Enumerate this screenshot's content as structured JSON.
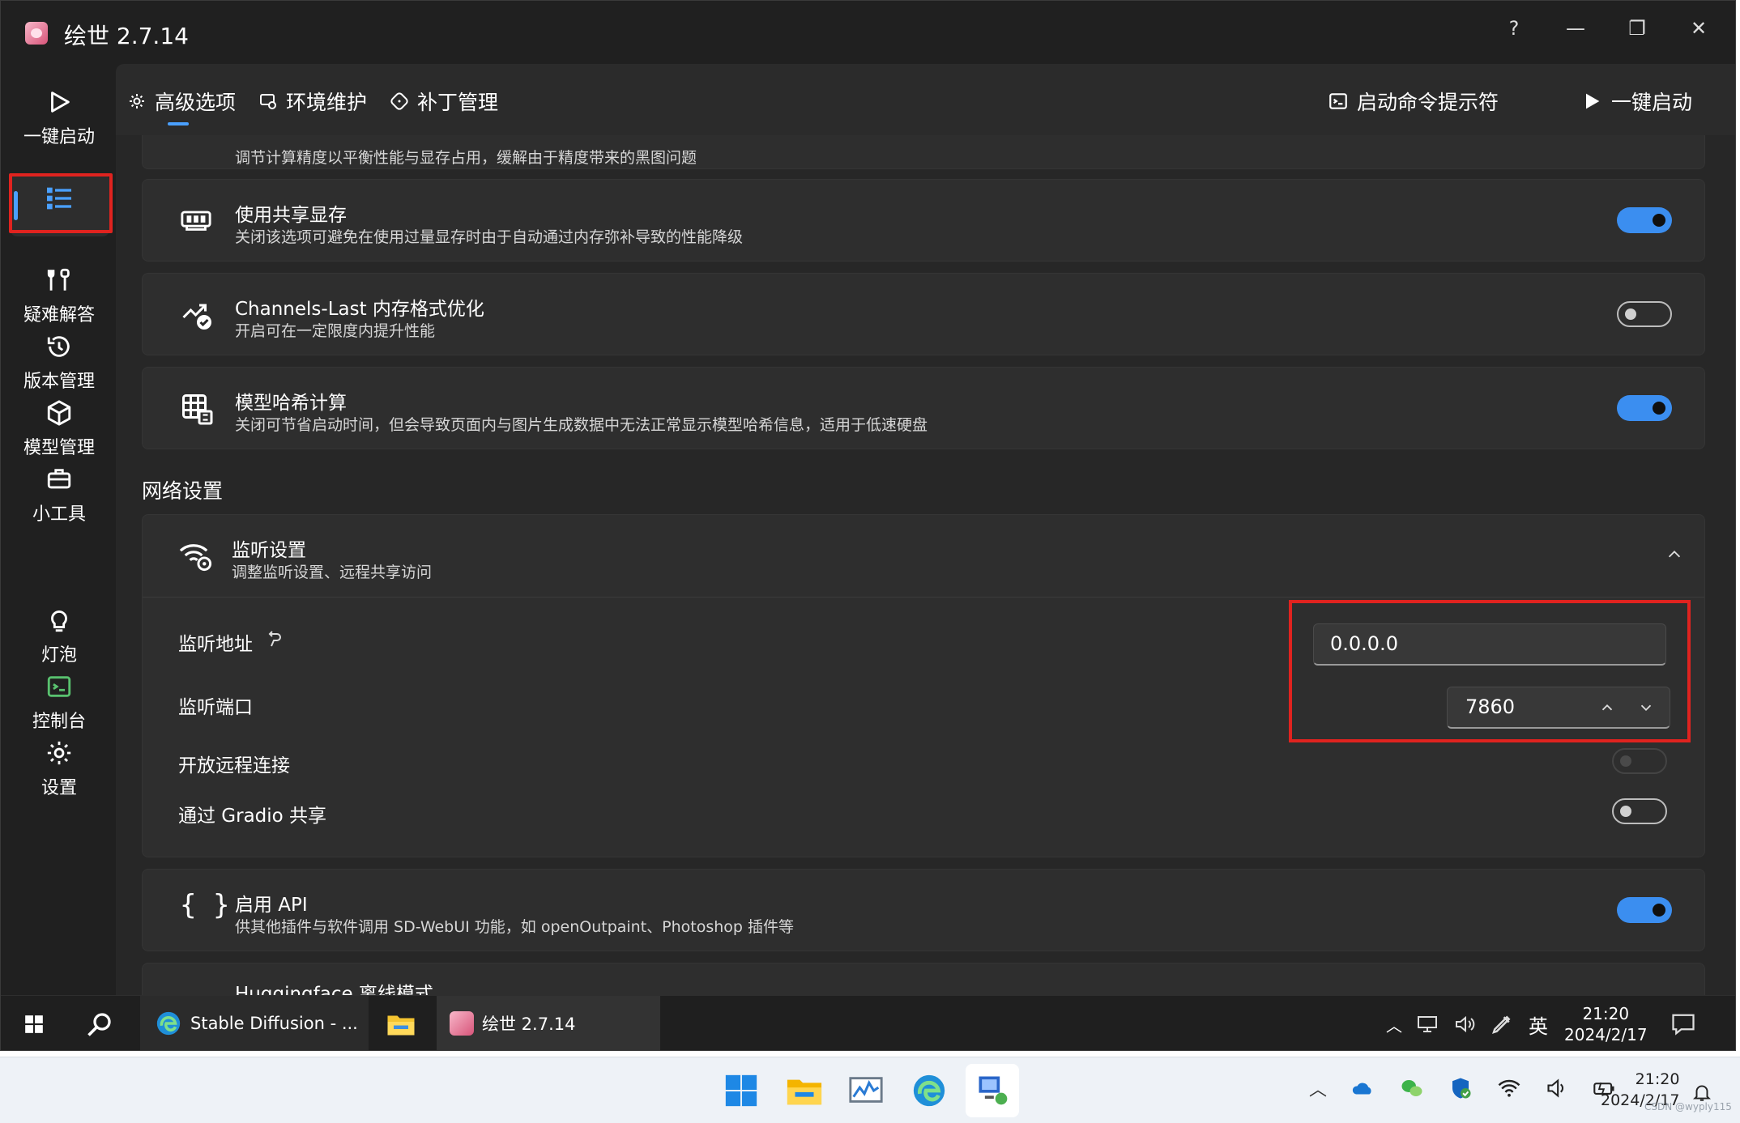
{
  "window": {
    "title": "绘世 2.7.14",
    "controls": {
      "help": "?",
      "minimize": "—",
      "restore": "❐",
      "close": "✕"
    }
  },
  "sidebar": {
    "items": [
      {
        "label": "一键启动",
        "icon": "play-icon"
      },
      {
        "label": "",
        "icon": "list-settings-icon",
        "active": true
      },
      {
        "label": "疑难解答",
        "icon": "wrench-icon"
      },
      {
        "label": "版本管理",
        "icon": "history-icon"
      },
      {
        "label": "模型管理",
        "icon": "cube-icon"
      },
      {
        "label": "小工具",
        "icon": "toolbox-icon"
      },
      {
        "label": "灯泡",
        "icon": "lightbulb-icon"
      },
      {
        "label": "控制台",
        "icon": "console-icon"
      },
      {
        "label": "设置",
        "icon": "gear-icon"
      }
    ]
  },
  "tabs": {
    "advanced": "高级选项",
    "environment": "环境维护",
    "patch": "补丁管理",
    "cmd": "启动命令提示符",
    "launch": "一键启动"
  },
  "settings": {
    "partial_desc": "调节计算精度以平衡性能与显存占用，缓解由于精度带来的黑图问题",
    "shared_vram": {
      "title": "使用共享显存",
      "desc": "关闭该选项可避免在使用过量显存时由于自动通过内存弥补导致的性能降级",
      "enabled": true
    },
    "channels_last": {
      "title": "Channels-Last 内存格式优化",
      "desc": "开启可在一定限度内提升性能",
      "enabled": false
    },
    "model_hash": {
      "title": "模型哈希计算",
      "desc": "关闭可节省启动时间，但会导致页面内与图片生成数据中无法正常显示模型哈希信息，适用于低速硬盘",
      "enabled": true
    },
    "network_section": "网络设置",
    "listen": {
      "title": "监听设置",
      "desc": "调整监听设置、远程共享访问",
      "address_label": "监听地址",
      "address_value": "0.0.0.0",
      "port_label": "监听端口",
      "port_value": "7860",
      "remote_label": "开放远程连接",
      "remote_enabled": false,
      "gradio_label": "通过 Gradio 共享",
      "gradio_enabled": false
    },
    "api": {
      "title": "启用 API",
      "desc": "供其他插件与软件调用 SD-WebUI 功能，如 openOutpaint、Photoshop 插件等",
      "enabled": true
    },
    "hf_offline": {
      "title": "Huggingface 离线模式"
    }
  },
  "taskbar": {
    "edge_label": "Stable Diffusion - ...",
    "app_label": "绘世 2.7.14",
    "ime": "英",
    "time": "21:20",
    "date": "2024/2/17"
  },
  "os_taskbar": {
    "time": "21:20",
    "date": "2024/2/17",
    "watermark": "CSDN @wyply115"
  },
  "colors": {
    "accent": "#3b8ef0",
    "highlight": "#e0231f",
    "background": "#202020",
    "card": "#2e2e2e"
  }
}
